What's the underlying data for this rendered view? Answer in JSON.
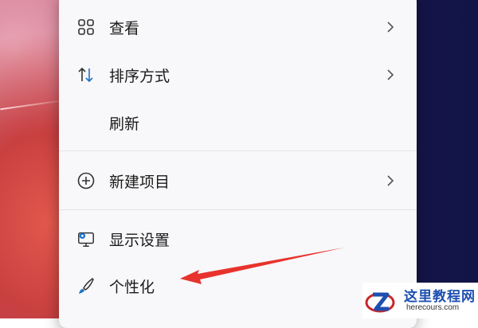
{
  "menu": {
    "items": [
      {
        "label": "查看",
        "icon": "grid-view-icon",
        "has_submenu": true
      },
      {
        "label": "排序方式",
        "icon": "sort-arrows-icon",
        "has_submenu": true
      },
      {
        "label": "刷新",
        "icon": "",
        "has_submenu": false
      },
      {
        "label": "新建项目",
        "icon": "plus-circle-icon",
        "has_submenu": true
      },
      {
        "label": "显示设置",
        "icon": "display-settings-icon",
        "has_submenu": false
      },
      {
        "label": "个性化",
        "icon": "brush-icon",
        "has_submenu": false
      }
    ]
  },
  "annotation": {
    "arrow_color": "#e8322d",
    "points_to": "个性化"
  },
  "watermark": {
    "title": "这里教程网",
    "url": "herecours.com"
  },
  "colors": {
    "menu_bg": "#f8f7f9",
    "accent_blue": "#1a73c8",
    "text": "#1b1b1b"
  }
}
